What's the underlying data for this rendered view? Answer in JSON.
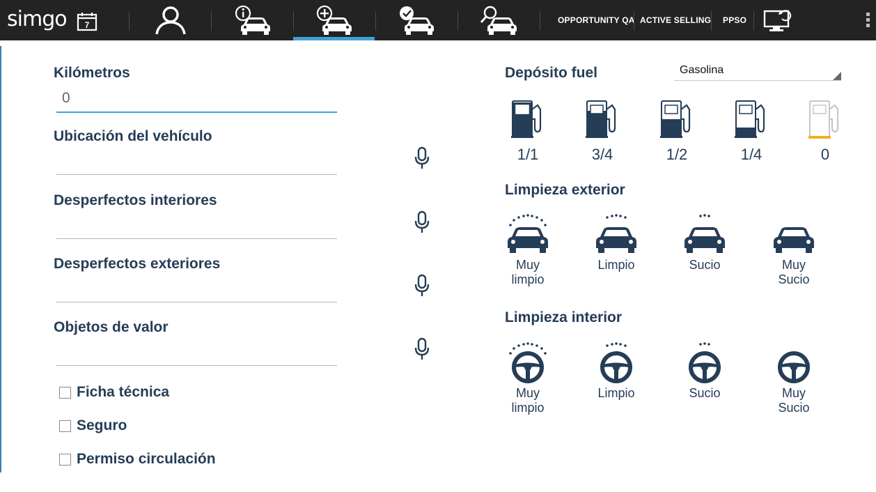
{
  "header": {
    "logo_text": "simgo",
    "calendar_day": "7",
    "nav_items": [
      {
        "name": "user-nav",
        "icon": "user-icon"
      },
      {
        "name": "vehicle-info-nav",
        "icon": "car-info-icon"
      },
      {
        "name": "vehicle-add-nav",
        "icon": "car-add-icon",
        "active": true
      },
      {
        "name": "vehicle-check-nav",
        "icon": "car-check-icon"
      },
      {
        "name": "vehicle-search-nav",
        "icon": "car-search-icon"
      }
    ],
    "text_links": [
      "OPPORTUNITY QA",
      "ACTIVE SELLING",
      "PPSO"
    ],
    "accent_color": "#41a1d2"
  },
  "form": {
    "km_label": "Kilómetros",
    "km_value": "0",
    "location_label": "Ubicación del vehículo",
    "location_value": "",
    "interior_damage_label": "Desperfectos interiores",
    "interior_damage_value": "",
    "exterior_damage_label": "Desperfectos exteriores",
    "exterior_damage_value": "",
    "valuables_label": "Objetos de valor",
    "valuables_value": "",
    "checkboxes": [
      {
        "label": "Ficha técnica",
        "checked": false
      },
      {
        "label": "Seguro",
        "checked": false
      },
      {
        "label": "Permiso circulación",
        "checked": false
      }
    ]
  },
  "fuel": {
    "title": "Depósito fuel",
    "type_selected": "Gasolina",
    "levels": [
      {
        "label": "1/1",
        "fill": 1.0
      },
      {
        "label": "3/4",
        "fill": 0.75
      },
      {
        "label": "1/2",
        "fill": 0.5
      },
      {
        "label": "1/4",
        "fill": 0.25
      },
      {
        "label": "0",
        "fill": 0
      }
    ]
  },
  "exterior_cleaning": {
    "title": "Limpieza exterior",
    "options": [
      "Muy limpio",
      "Limpio",
      "Sucio",
      "Muy Sucio"
    ]
  },
  "interior_cleaning": {
    "title": "Limpieza interior",
    "options": [
      "Muy limpio",
      "Limpio",
      "Sucio",
      "Muy Sucio"
    ]
  }
}
